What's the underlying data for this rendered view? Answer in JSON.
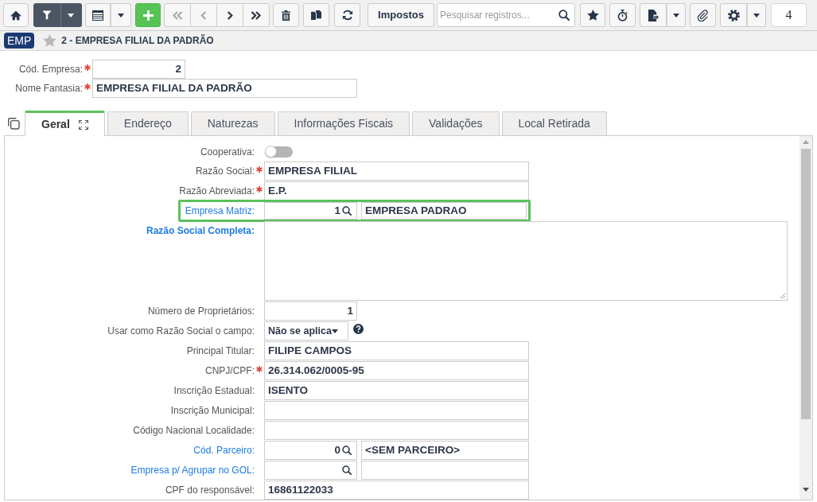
{
  "toolbar": {
    "filter": {
      "active": true
    },
    "navigation": [
      {
        "kind": "first",
        "disabled": true
      },
      {
        "kind": "previous",
        "disabled": true
      },
      {
        "kind": "next",
        "disabled": false
      },
      {
        "kind": "last",
        "disabled": false
      }
    ],
    "impostos_button": "Impostos",
    "search": {
      "placeholder": "Pesquisar registros..."
    },
    "counter": "4"
  },
  "breadcrumb": {
    "badge": "EMP",
    "favorite": false,
    "title": "2 - EMPRESA FILIAL DA PADRÃO"
  },
  "header_fields": [
    {
      "kind": "number",
      "label": "Cód. Empresa:",
      "required": true,
      "value": "2"
    },
    {
      "kind": "text",
      "label": "Nome Fantasia:",
      "required": true,
      "value": "EMPRESA FILIAL DA PADRÃO"
    }
  ],
  "tabs": [
    {
      "label": "Geral",
      "selected": true
    },
    {
      "label": "Endereço",
      "selected": false
    },
    {
      "label": "Naturezas",
      "selected": false
    },
    {
      "label": "Informações Fiscais",
      "selected": false
    },
    {
      "label": "Validações",
      "selected": false
    },
    {
      "label": "Local Retirada",
      "selected": false
    }
  ],
  "form": {
    "fields": [
      {
        "kind": "toggle",
        "label": "Cooperativa:",
        "required": false,
        "link": false,
        "highlighted": false,
        "on": false
      },
      {
        "kind": "text",
        "label": "Razão Social:",
        "required": true,
        "link": false,
        "highlighted": false,
        "value": "EMPRESA FILIAL"
      },
      {
        "kind": "text",
        "label": "Razão Abreviada:",
        "required": true,
        "link": false,
        "highlighted": false,
        "value": "E.P."
      },
      {
        "kind": "lookup",
        "label": "Empresa Matriz:",
        "required": false,
        "link": true,
        "highlighted": true,
        "code": "1",
        "description": "EMPRESA PADRAO"
      },
      {
        "kind": "textarea",
        "label": "Razão Social Completa:",
        "required": false,
        "link": true,
        "highlighted": false
      },
      {
        "kind": "number",
        "label": "Número de Proprietários:",
        "required": false,
        "link": false,
        "highlighted": false,
        "value": "1"
      },
      {
        "kind": "select",
        "label": "Usar como Razão Social o campo:",
        "required": false,
        "link": false,
        "highlighted": false,
        "value": "Não se aplica",
        "help": true
      },
      {
        "kind": "text",
        "label": "Principal Titular:",
        "required": false,
        "link": false,
        "highlighted": false,
        "value": "FILIPE CAMPOS"
      },
      {
        "kind": "text",
        "label": "CNPJ/CPF:",
        "required": true,
        "link": false,
        "highlighted": false,
        "value": "26.314.062/0005-95"
      },
      {
        "kind": "text",
        "label": "Inscrição Estadual:",
        "required": false,
        "link": false,
        "highlighted": false,
        "value": "ISENTO"
      },
      {
        "kind": "text",
        "label": "Inscrição Municipal:",
        "required": false,
        "link": false,
        "highlighted": false
      },
      {
        "kind": "text",
        "label": "Código Nacional Localidade:",
        "required": false,
        "link": false,
        "highlighted": false
      },
      {
        "kind": "lookup",
        "label": "Cód. Parceiro:",
        "required": false,
        "link": true,
        "highlighted": false,
        "code": "0",
        "description": "<SEM PARCEIRO>"
      },
      {
        "kind": "lookup",
        "label": "Empresa p/ Agrupar no GOL:",
        "required": false,
        "link": true,
        "highlighted": false
      },
      {
        "kind": "text",
        "label": "CPF do responsável:",
        "required": false,
        "link": false,
        "highlighted": false,
        "value": "16861122033"
      }
    ]
  }
}
